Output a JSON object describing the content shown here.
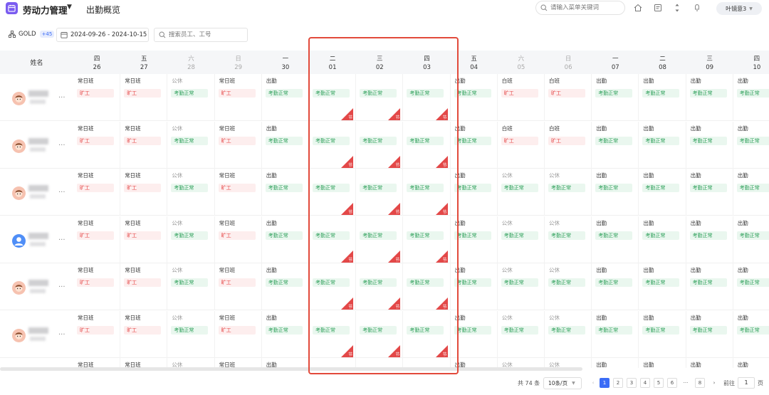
{
  "header": {
    "app_title": "劳动力管理",
    "page_title": "出勤概览",
    "menu_search_placeholder": "请输入菜单关键词",
    "user_name": "叶镜意3"
  },
  "colors": {
    "accent": "#3b6cf6",
    "logo": "#7a5cf0",
    "absent": "#e54545",
    "normal": "#2ea05a",
    "holiday": "#e34848"
  },
  "filters": {
    "group_name": "GOLD",
    "group_badge": "+45",
    "date_range": "2024-09-26 - 2024-10-15",
    "employee_search_placeholder": "搜索员工、工号"
  },
  "grid": {
    "name_header": "姓名",
    "days": [
      {
        "weekday": "四",
        "date": "26",
        "weekend": false
      },
      {
        "weekday": "五",
        "date": "27",
        "weekend": false
      },
      {
        "weekday": "六",
        "date": "28",
        "weekend": true
      },
      {
        "weekday": "日",
        "date": "29",
        "weekend": true
      },
      {
        "weekday": "一",
        "date": "30",
        "weekend": false
      },
      {
        "weekday": "二",
        "date": "01",
        "weekend": false
      },
      {
        "weekday": "三",
        "date": "02",
        "weekend": false
      },
      {
        "weekday": "四",
        "date": "03",
        "weekend": false
      },
      {
        "weekday": "五",
        "date": "04",
        "weekend": false
      },
      {
        "weekday": "六",
        "date": "05",
        "weekend": true
      },
      {
        "weekday": "日",
        "date": "06",
        "weekend": true
      },
      {
        "weekday": "一",
        "date": "07",
        "weekend": false
      },
      {
        "weekday": "二",
        "date": "08",
        "weekend": false
      },
      {
        "weekday": "三",
        "date": "09",
        "weekend": false
      },
      {
        "weekday": "四",
        "date": "10",
        "weekend": false
      }
    ],
    "more_label": "···",
    "holiday_label": "节",
    "rows": [
      {
        "avatar": "pink",
        "cells": [
          {
            "shift": "常日班",
            "status": "旷工",
            "type": "absent"
          },
          {
            "shift": "常日班",
            "status": "旷工",
            "type": "absent"
          },
          {
            "shift": "公休",
            "status": "考勤正常",
            "type": "normal",
            "off": true
          },
          {
            "shift": "常日班",
            "status": "旷工",
            "type": "absent"
          },
          {
            "shift": "出勤",
            "status": "考勤正常",
            "type": "normal"
          },
          {
            "shift": "",
            "status": "考勤正常",
            "type": "normal",
            "holiday": true
          },
          {
            "shift": "",
            "status": "考勤正常",
            "type": "normal",
            "holiday": true
          },
          {
            "shift": "",
            "status": "考勤正常",
            "type": "normal",
            "holiday": true
          },
          {
            "shift": "出勤",
            "status": "考勤正常",
            "type": "normal"
          },
          {
            "shift": "白班",
            "status": "旷工",
            "type": "absent"
          },
          {
            "shift": "白班",
            "status": "旷工",
            "type": "absent"
          },
          {
            "shift": "出勤",
            "status": "考勤正常",
            "type": "normal"
          },
          {
            "shift": "出勤",
            "status": "考勤正常",
            "type": "normal"
          },
          {
            "shift": "出勤",
            "status": "考勤正常",
            "type": "normal"
          },
          {
            "shift": "出勤",
            "status": "考勤正常",
            "type": "normal"
          }
        ]
      },
      {
        "avatar": "pink",
        "cells": [
          {
            "shift": "常日班",
            "status": "旷工",
            "type": "absent"
          },
          {
            "shift": "常日班",
            "status": "旷工",
            "type": "absent"
          },
          {
            "shift": "公休",
            "status": "考勤正常",
            "type": "normal",
            "off": true
          },
          {
            "shift": "常日班",
            "status": "旷工",
            "type": "absent"
          },
          {
            "shift": "出勤",
            "status": "考勤正常",
            "type": "normal"
          },
          {
            "shift": "",
            "status": "考勤正常",
            "type": "normal",
            "holiday": true
          },
          {
            "shift": "",
            "status": "考勤正常",
            "type": "normal",
            "holiday": true
          },
          {
            "shift": "",
            "status": "考勤正常",
            "type": "normal",
            "holiday": true
          },
          {
            "shift": "出勤",
            "status": "考勤正常",
            "type": "normal"
          },
          {
            "shift": "白班",
            "status": "旷工",
            "type": "absent"
          },
          {
            "shift": "白班",
            "status": "旷工",
            "type": "absent"
          },
          {
            "shift": "出勤",
            "status": "考勤正常",
            "type": "normal"
          },
          {
            "shift": "出勤",
            "status": "考勤正常",
            "type": "normal"
          },
          {
            "shift": "出勤",
            "status": "考勤正常",
            "type": "normal"
          },
          {
            "shift": "出勤",
            "status": "考勤正常",
            "type": "normal"
          }
        ]
      },
      {
        "avatar": "pink",
        "cells": [
          {
            "shift": "常日班",
            "status": "旷工",
            "type": "absent"
          },
          {
            "shift": "常日班",
            "status": "旷工",
            "type": "absent"
          },
          {
            "shift": "公休",
            "status": "考勤正常",
            "type": "normal",
            "off": true
          },
          {
            "shift": "常日班",
            "status": "旷工",
            "type": "absent"
          },
          {
            "shift": "出勤",
            "status": "考勤正常",
            "type": "normal"
          },
          {
            "shift": "",
            "status": "考勤正常",
            "type": "normal",
            "holiday": true
          },
          {
            "shift": "",
            "status": "考勤正常",
            "type": "normal",
            "holiday": true
          },
          {
            "shift": "",
            "status": "考勤正常",
            "type": "normal",
            "holiday": true
          },
          {
            "shift": "出勤",
            "status": "考勤正常",
            "type": "normal"
          },
          {
            "shift": "公休",
            "status": "考勤正常",
            "type": "normal",
            "off": true
          },
          {
            "shift": "公休",
            "status": "考勤正常",
            "type": "normal",
            "off": true
          },
          {
            "shift": "出勤",
            "status": "考勤正常",
            "type": "normal"
          },
          {
            "shift": "出勤",
            "status": "考勤正常",
            "type": "normal"
          },
          {
            "shift": "出勤",
            "status": "考勤正常",
            "type": "normal"
          },
          {
            "shift": "出勤",
            "status": "考勤正常",
            "type": "normal"
          }
        ]
      },
      {
        "avatar": "blue",
        "cells": [
          {
            "shift": "常日班",
            "status": "旷工",
            "type": "absent"
          },
          {
            "shift": "常日班",
            "status": "旷工",
            "type": "absent"
          },
          {
            "shift": "公休",
            "status": "考勤正常",
            "type": "normal",
            "off": true
          },
          {
            "shift": "常日班",
            "status": "旷工",
            "type": "absent"
          },
          {
            "shift": "出勤",
            "status": "考勤正常",
            "type": "normal"
          },
          {
            "shift": "",
            "status": "考勤正常",
            "type": "normal",
            "holiday": true
          },
          {
            "shift": "",
            "status": "考勤正常",
            "type": "normal",
            "holiday": true
          },
          {
            "shift": "",
            "status": "考勤正常",
            "type": "normal",
            "holiday": true
          },
          {
            "shift": "出勤",
            "status": "考勤正常",
            "type": "normal"
          },
          {
            "shift": "公休",
            "status": "考勤正常",
            "type": "normal",
            "off": true
          },
          {
            "shift": "公休",
            "status": "考勤正常",
            "type": "normal",
            "off": true
          },
          {
            "shift": "出勤",
            "status": "考勤正常",
            "type": "normal"
          },
          {
            "shift": "出勤",
            "status": "考勤正常",
            "type": "normal"
          },
          {
            "shift": "出勤",
            "status": "考勤正常",
            "type": "normal"
          },
          {
            "shift": "出勤",
            "status": "考勤正常",
            "type": "normal"
          }
        ]
      },
      {
        "avatar": "pink",
        "cells": [
          {
            "shift": "常日班",
            "status": "旷工",
            "type": "absent"
          },
          {
            "shift": "常日班",
            "status": "旷工",
            "type": "absent"
          },
          {
            "shift": "公休",
            "status": "考勤正常",
            "type": "normal",
            "off": true
          },
          {
            "shift": "常日班",
            "status": "旷工",
            "type": "absent"
          },
          {
            "shift": "出勤",
            "status": "考勤正常",
            "type": "normal"
          },
          {
            "shift": "",
            "status": "考勤正常",
            "type": "normal",
            "holiday": true
          },
          {
            "shift": "",
            "status": "考勤正常",
            "type": "normal",
            "holiday": true
          },
          {
            "shift": "",
            "status": "考勤正常",
            "type": "normal",
            "holiday": true
          },
          {
            "shift": "出勤",
            "status": "考勤正常",
            "type": "normal"
          },
          {
            "shift": "公休",
            "status": "考勤正常",
            "type": "normal",
            "off": true
          },
          {
            "shift": "公休",
            "status": "考勤正常",
            "type": "normal",
            "off": true
          },
          {
            "shift": "出勤",
            "status": "考勤正常",
            "type": "normal"
          },
          {
            "shift": "出勤",
            "status": "考勤正常",
            "type": "normal"
          },
          {
            "shift": "出勤",
            "status": "考勤正常",
            "type": "normal"
          },
          {
            "shift": "出勤",
            "status": "考勤正常",
            "type": "normal"
          }
        ]
      },
      {
        "avatar": "pink",
        "cells": [
          {
            "shift": "常日班",
            "status": "旷工",
            "type": "absent"
          },
          {
            "shift": "常日班",
            "status": "旷工",
            "type": "absent"
          },
          {
            "shift": "公休",
            "status": "考勤正常",
            "type": "normal",
            "off": true
          },
          {
            "shift": "常日班",
            "status": "旷工",
            "type": "absent"
          },
          {
            "shift": "出勤",
            "status": "考勤正常",
            "type": "normal"
          },
          {
            "shift": "",
            "status": "考勤正常",
            "type": "normal",
            "holiday": true
          },
          {
            "shift": "",
            "status": "考勤正常",
            "type": "normal",
            "holiday": true
          },
          {
            "shift": "",
            "status": "考勤正常",
            "type": "normal",
            "holiday": true
          },
          {
            "shift": "出勤",
            "status": "考勤正常",
            "type": "normal"
          },
          {
            "shift": "公休",
            "status": "考勤正常",
            "type": "normal",
            "off": true
          },
          {
            "shift": "公休",
            "status": "考勤正常",
            "type": "normal",
            "off": true
          },
          {
            "shift": "出勤",
            "status": "考勤正常",
            "type": "normal"
          },
          {
            "shift": "出勤",
            "status": "考勤正常",
            "type": "normal"
          },
          {
            "shift": "出勤",
            "status": "考勤正常",
            "type": "normal"
          },
          {
            "shift": "出勤",
            "status": "考勤正常",
            "type": "normal"
          }
        ]
      },
      {
        "avatar": "pink",
        "cells": [
          {
            "shift": "常日班",
            "status": "",
            "type": ""
          },
          {
            "shift": "常日班",
            "status": "",
            "type": ""
          },
          {
            "shift": "公休",
            "status": "",
            "type": "",
            "off": true
          },
          {
            "shift": "常日班",
            "status": "",
            "type": ""
          },
          {
            "shift": "出勤",
            "status": "",
            "type": ""
          },
          {
            "shift": "",
            "status": "",
            "type": ""
          },
          {
            "shift": "",
            "status": "",
            "type": ""
          },
          {
            "shift": "",
            "status": "",
            "type": ""
          },
          {
            "shift": "出勤",
            "status": "",
            "type": ""
          },
          {
            "shift": "公休",
            "status": "",
            "type": "",
            "off": true
          },
          {
            "shift": "公休",
            "status": "",
            "type": "",
            "off": true
          },
          {
            "shift": "出勤",
            "status": "",
            "type": ""
          },
          {
            "shift": "出勤",
            "status": "",
            "type": ""
          },
          {
            "shift": "出勤",
            "status": "",
            "type": ""
          },
          {
            "shift": "出勤",
            "status": "",
            "type": ""
          }
        ]
      }
    ]
  },
  "pagination": {
    "total": "共 74 条",
    "page_size": "10条/页",
    "prev": "‹",
    "pages": [
      "1",
      "2",
      "3",
      "4",
      "5",
      "6",
      "···",
      "8"
    ],
    "current": "1",
    "next": "›",
    "goto_label": "前往",
    "goto_value": "1",
    "goto_unit": "页"
  }
}
